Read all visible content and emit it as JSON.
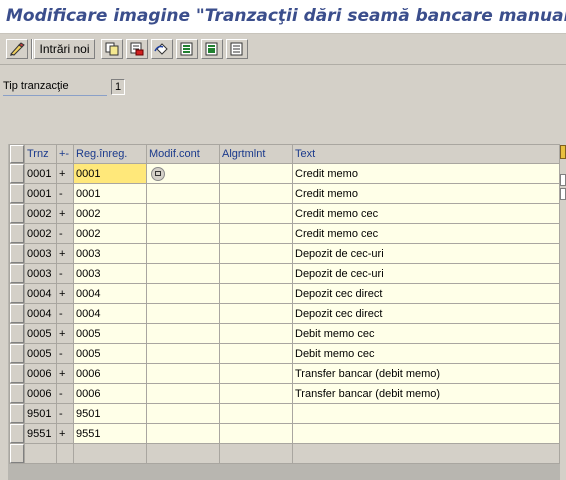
{
  "window": {
    "title": "Modificare imagine \"Tranzacţii dări seamă bancare manuale\": Ima"
  },
  "toolbar": {
    "new_entries_label": "Intrări noi",
    "icons": [
      "change-icon",
      "copy-icon",
      "delete-icon",
      "undo-icon",
      "select-all-icon",
      "select-block-icon",
      "deselect-all-icon"
    ]
  },
  "field": {
    "label": "Tip tranzacţie",
    "value": "1"
  },
  "table": {
    "columns": [
      "Trnz",
      "+-",
      "Reg.înreg.",
      "Modif.cont",
      "Algrtmlnt",
      "Text"
    ],
    "rows": [
      {
        "trnz": "0001",
        "sign": "+",
        "reg": "0001",
        "modif": "",
        "algrt": "",
        "text": "Credit memo"
      },
      {
        "trnz": "0001",
        "sign": "-",
        "reg": "0001",
        "modif": "",
        "algrt": "",
        "text": "Credit memo"
      },
      {
        "trnz": "0002",
        "sign": "+",
        "reg": "0002",
        "modif": "",
        "algrt": "",
        "text": "Credit memo cec"
      },
      {
        "trnz": "0002",
        "sign": "-",
        "reg": "0002",
        "modif": "",
        "algrt": "",
        "text": "Credit memo cec"
      },
      {
        "trnz": "0003",
        "sign": "+",
        "reg": "0003",
        "modif": "",
        "algrt": "",
        "text": "Depozit de cec-uri"
      },
      {
        "trnz": "0003",
        "sign": "-",
        "reg": "0003",
        "modif": "",
        "algrt": "",
        "text": "Depozit de cec-uri"
      },
      {
        "trnz": "0004",
        "sign": "+",
        "reg": "0004",
        "modif": "",
        "algrt": "",
        "text": "Depozit cec direct"
      },
      {
        "trnz": "0004",
        "sign": "-",
        "reg": "0004",
        "modif": "",
        "algrt": "",
        "text": "Depozit cec direct"
      },
      {
        "trnz": "0005",
        "sign": "+",
        "reg": "0005",
        "modif": "",
        "algrt": "",
        "text": "Debit memo cec"
      },
      {
        "trnz": "0005",
        "sign": "-",
        "reg": "0005",
        "modif": "",
        "algrt": "",
        "text": "Debit memo cec"
      },
      {
        "trnz": "0006",
        "sign": "+",
        "reg": "0006",
        "modif": "",
        "algrt": "",
        "text": "Transfer bancar (debit memo)"
      },
      {
        "trnz": "0006",
        "sign": "-",
        "reg": "0006",
        "modif": "",
        "algrt": "",
        "text": "Transfer bancar (debit memo)"
      },
      {
        "trnz": "9501",
        "sign": "-",
        "reg": "9501",
        "modif": "",
        "algrt": "",
        "text": ""
      },
      {
        "trnz": "9551",
        "sign": "+",
        "reg": "9551",
        "modif": "",
        "algrt": "",
        "text": ""
      }
    ]
  },
  "colors": {
    "title": "#3b4e8c",
    "header_text": "#1b3a8c",
    "cell_bg": "#ffffe8",
    "focus_cell": "#ffe87a",
    "window_bg": "#d4d0c8"
  }
}
